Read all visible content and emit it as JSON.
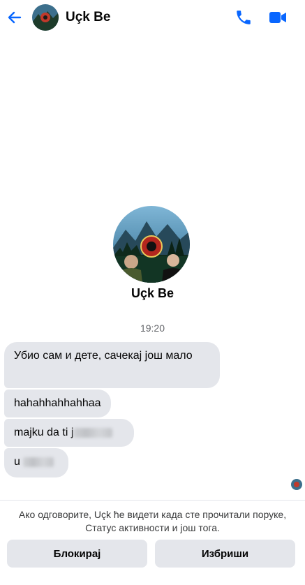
{
  "header": {
    "contact_name": "Uçk Be",
    "icons": [
      "back-arrow-icon",
      "phone-icon",
      "video-camera-icon"
    ]
  },
  "profile": {
    "name": "Uçk Be"
  },
  "conversation": {
    "timestamp": "19:20",
    "messages": [
      {
        "text": "Убио сам и дете, сачекај још мало"
      },
      {
        "text": "hahahhahhahhaa"
      },
      {
        "text": "majku da ti j"
      },
      {
        "text": "u"
      }
    ]
  },
  "footer": {
    "notice": "Ако одговорите, Uçk ће видети када сте прочитали поруке, Статус активности и још тога.",
    "block_label": "Блокирај",
    "delete_label": "Избриши"
  },
  "colors": {
    "accent": "#0866ff",
    "bubble": "#e4e6eb",
    "button": "#e4e6eb"
  }
}
